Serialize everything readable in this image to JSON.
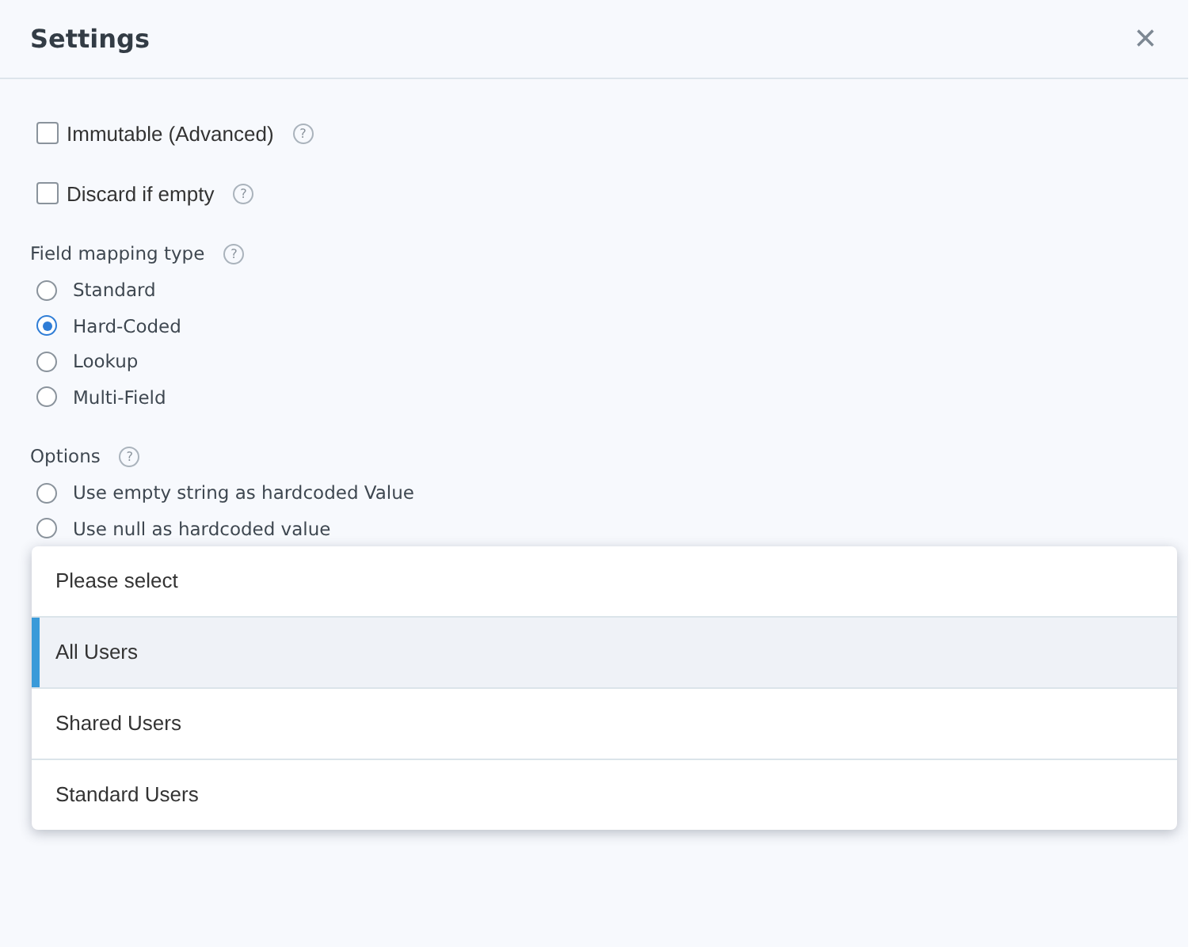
{
  "dialog": {
    "title": "Settings",
    "close": "×"
  },
  "checkboxes": [
    {
      "label": "Immutable (Advanced)",
      "checked": false,
      "help": "?"
    },
    {
      "label": "Discard if empty",
      "checked": false,
      "help": "?"
    }
  ],
  "field_mapping_type": {
    "label": "Field mapping type",
    "help": "?",
    "options": [
      {
        "label": "Standard",
        "selected": false
      },
      {
        "label": "Hard-Coded",
        "selected": true
      },
      {
        "label": "Lookup",
        "selected": false
      },
      {
        "label": "Multi-Field",
        "selected": false
      }
    ]
  },
  "options": {
    "label": "Options",
    "help": "?",
    "options": [
      {
        "label": "Use empty string as hardcoded Value",
        "selected": false
      },
      {
        "label": "Use null as hardcoded value",
        "selected": false
      }
    ]
  },
  "dropdown_menu": {
    "items": [
      {
        "label": "Please select",
        "selected": false
      },
      {
        "label": "All Users",
        "selected": true
      },
      {
        "label": "Shared Users",
        "selected": false
      },
      {
        "label": "Standard Users",
        "selected": false
      }
    ]
  }
}
